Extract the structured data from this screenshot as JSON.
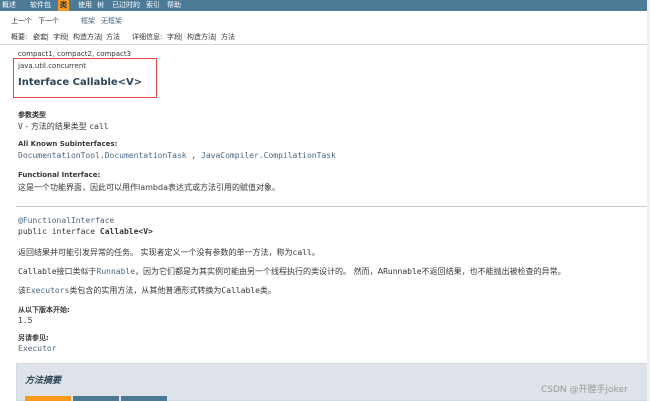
{
  "nav": {
    "items": [
      "概述",
      "软件包",
      "类",
      "使用",
      "树",
      "已过时的",
      "索引",
      "帮助"
    ],
    "active_index": 2,
    "prev": "上一个",
    "next": "下一个",
    "frames": "框架",
    "no_frames": "无框架",
    "summary_label": "概要:",
    "summary_links": [
      "嵌套",
      "字段",
      "构造方法",
      "方法"
    ],
    "detail_label": "详细信息:",
    "detail_links": [
      "字段",
      "构造方法",
      "方法"
    ],
    "sep": " | "
  },
  "header": {
    "profiles": "compact1, compact2, compact3",
    "package": "java.util.concurrent",
    "title": "Interface Callable<V>"
  },
  "type_params": {
    "heading": "参数类型",
    "param": "V",
    "dash": " - ",
    "desc": "方法的结果类型",
    "method": "call"
  },
  "subinterfaces": {
    "heading": "All Known Subinterfaces:",
    "first": "DocumentationTool.DocumentationTask",
    "comma": " , ",
    "second": "JavaCompiler.CompilationTask"
  },
  "functional": {
    "heading": "Functional Interface:",
    "text": "这是一个功能界面，因此可以用作lambda表达式或方法引用的赋值对象。"
  },
  "signature": {
    "annotation": "@FunctionalInterface",
    "prefix": "public interface ",
    "name": "Callable<V>"
  },
  "description": {
    "p1_text": "返回结果并可能引发异常的任务。 实现者定义一个没有参数的单一方法，称为",
    "p1_code": "call",
    "p1_end": "。",
    "p2_a": "Callable",
    "p2_b": "接口类似于",
    "p2_c": "Runnable",
    "p2_d": "，因为它们都是为其实例可能由另一个线程执行的类设计的。 然而，A",
    "p2_e": "Runnable",
    "p2_f": "不返回结果，也不能抛出被检查的异常。",
    "p3_a": "该",
    "p3_b": "Executors",
    "p3_c": "类包含的实用方法，从其他普通形式转换为",
    "p3_d": "Callable",
    "p3_e": "类。"
  },
  "since": {
    "heading": "从以下版本开始:",
    "value": "1.5"
  },
  "see_also": {
    "heading": "另请参见:",
    "link": "Executor"
  },
  "method_summary": {
    "heading": "方法摘要"
  },
  "watermark": "CSDN @开膛手joker",
  "colors": {
    "nav_bg": "#4d7a97",
    "active_tab": "#f8981d",
    "link": "#4a6782",
    "highlight_box": "#e04848",
    "summary_bg": "#dee3e9"
  }
}
